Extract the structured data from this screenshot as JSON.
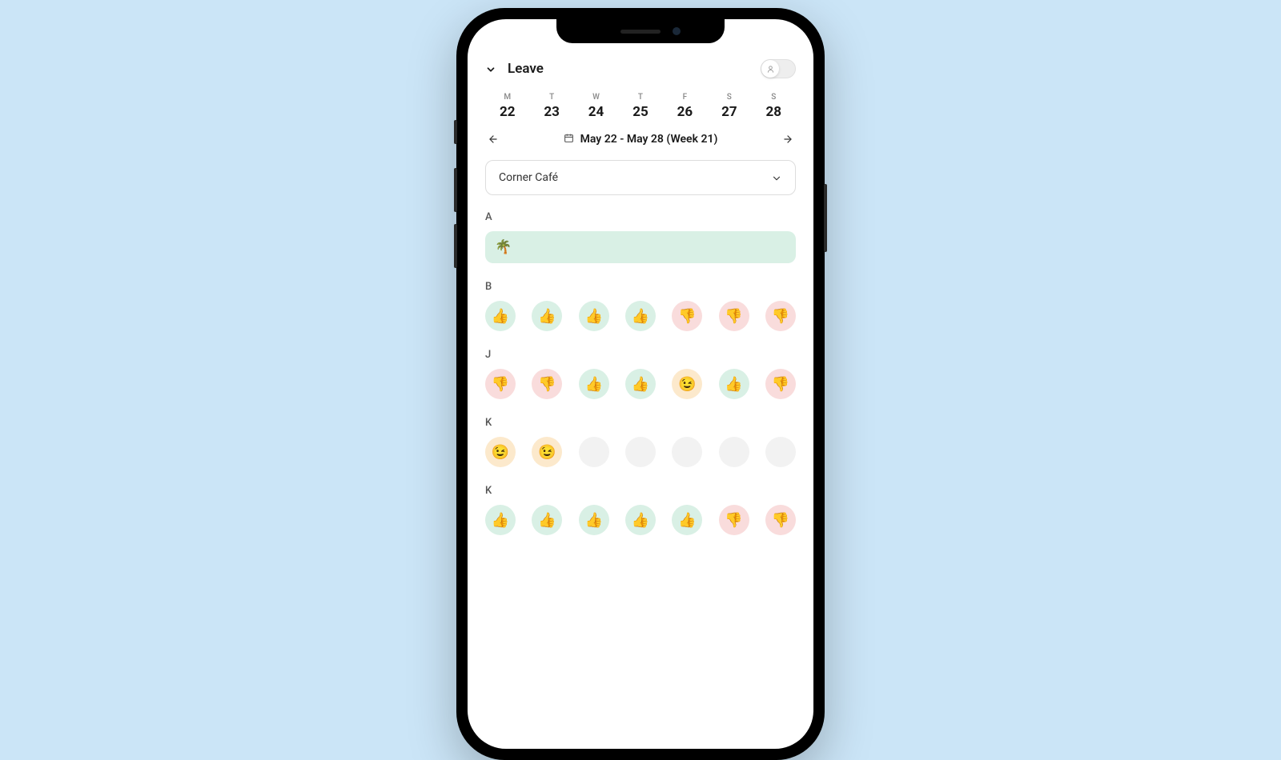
{
  "header": {
    "title": "Leave"
  },
  "days": [
    {
      "letter": "M",
      "num": "22"
    },
    {
      "letter": "T",
      "num": "23"
    },
    {
      "letter": "W",
      "num": "24"
    },
    {
      "letter": "T",
      "num": "25"
    },
    {
      "letter": "F",
      "num": "26"
    },
    {
      "letter": "S",
      "num": "27"
    },
    {
      "letter": "S",
      "num": "28"
    }
  ],
  "week": {
    "label": "May 22 - May 28 (Week 21)"
  },
  "location": {
    "selected": "Corner Café"
  },
  "sections": [
    {
      "label": "A",
      "type": "leave",
      "emoji": "🌴"
    },
    {
      "label": "B",
      "type": "row",
      "cells": [
        "up",
        "up",
        "up",
        "up",
        "down",
        "down",
        "down"
      ]
    },
    {
      "label": "J",
      "type": "row",
      "cells": [
        "down",
        "down",
        "up",
        "up",
        "wink",
        "up",
        "down"
      ]
    },
    {
      "label": "K",
      "type": "row",
      "cells": [
        "wink",
        "wink",
        "empty",
        "empty",
        "empty",
        "empty",
        "empty"
      ]
    },
    {
      "label": "K",
      "type": "row",
      "cells": [
        "up",
        "up",
        "up",
        "up",
        "up",
        "down",
        "down"
      ]
    }
  ],
  "emoji": {
    "up": "👍",
    "down": "👎",
    "wink": "😉",
    "empty": ""
  }
}
